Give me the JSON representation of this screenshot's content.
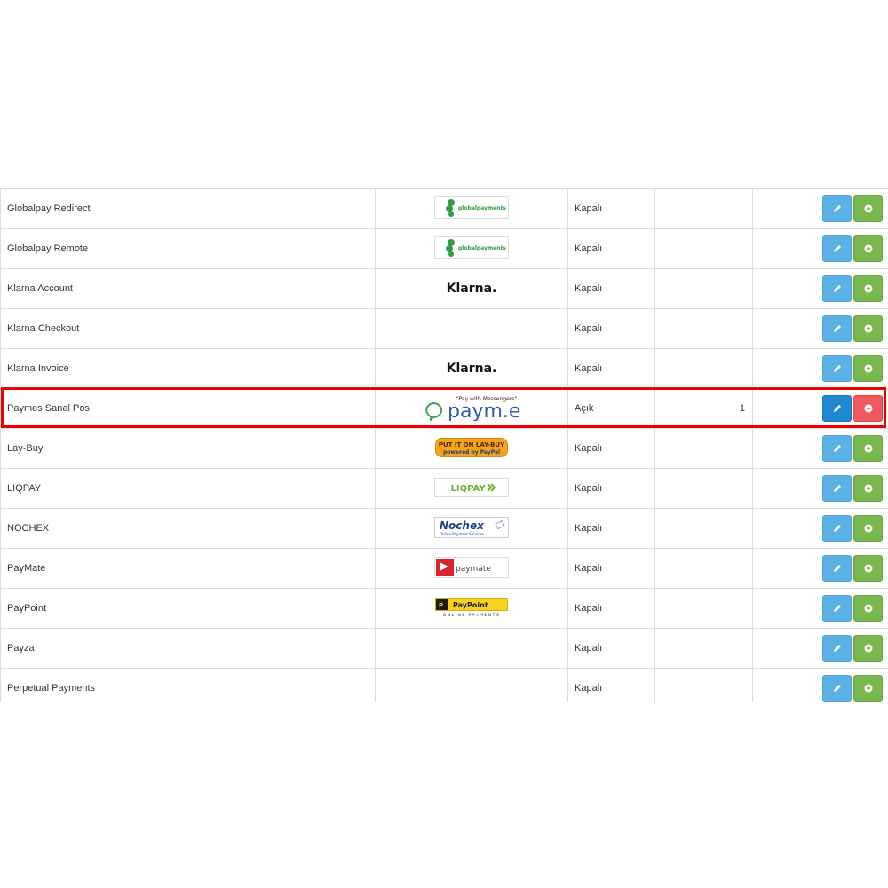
{
  "rows": [
    {
      "name": "Globalpay Redirect",
      "logo": "globalpayments-logo",
      "logo_text": "globalpayments",
      "status": "Kapalı",
      "order": "",
      "installed": false
    },
    {
      "name": "Globalpay Remote",
      "logo": "globalpayments-logo",
      "logo_text": "globalpayments",
      "status": "Kapalı",
      "order": "",
      "installed": false
    },
    {
      "name": "Klarna Account",
      "logo": "klarna-logo",
      "logo_text": "Klarna.",
      "status": "Kapalı",
      "order": "",
      "installed": false
    },
    {
      "name": "Klarna Checkout",
      "logo": "",
      "logo_text": "",
      "status": "Kapalı",
      "order": "",
      "installed": false
    },
    {
      "name": "Klarna Invoice",
      "logo": "klarna-logo",
      "logo_text": "Klarna.",
      "status": "Kapalı",
      "order": "",
      "installed": false
    },
    {
      "name": "Paymes Sanal Pos",
      "logo": "paymes-logo",
      "logo_text": "paym.es",
      "logo_subtext": "\"Pay with Messengers\"",
      "status": "Açık",
      "order": "1",
      "installed": true
    },
    {
      "name": "Lay-Buy",
      "logo": "laybuy-logo",
      "logo_text": "PUT IT ON LAY-BUY",
      "logo_subtext": "powered by PayPal",
      "status": "Kapalı",
      "order": "",
      "installed": false
    },
    {
      "name": "LIQPAY",
      "logo": "liqpay-logo",
      "logo_text": "LIQPAY",
      "status": "Kapalı",
      "order": "",
      "installed": false
    },
    {
      "name": "NOCHEX",
      "logo": "nochex-logo",
      "logo_text": "Nochex",
      "logo_subtext": "Online Payment Services",
      "status": "Kapalı",
      "order": "",
      "installed": false
    },
    {
      "name": "PayMate",
      "logo": "paymate-logo",
      "logo_text": "paymate",
      "status": "Kapalı",
      "order": "",
      "installed": false
    },
    {
      "name": "PayPoint",
      "logo": "paypoint-logo",
      "logo_text": "PayPoint",
      "logo_subtext": "ONLINE PAYMENTS",
      "status": "Kapalı",
      "order": "",
      "installed": false
    },
    {
      "name": "Payza",
      "logo": "",
      "logo_text": "",
      "status": "Kapalı",
      "order": "",
      "installed": false
    },
    {
      "name": "Perpetual Payments",
      "logo": "",
      "logo_text": "",
      "status": "Kapalı",
      "order": "",
      "installed": false
    }
  ],
  "colors": {
    "edit": "#5bb0e4",
    "edit_active": "#1e88d1",
    "install": "#78b84f",
    "uninstall": "#f05a5e",
    "highlight": "#ee0000"
  },
  "icons": {
    "edit": "pencil-icon",
    "install": "plus-circle-icon",
    "uninstall": "minus-circle-icon"
  }
}
